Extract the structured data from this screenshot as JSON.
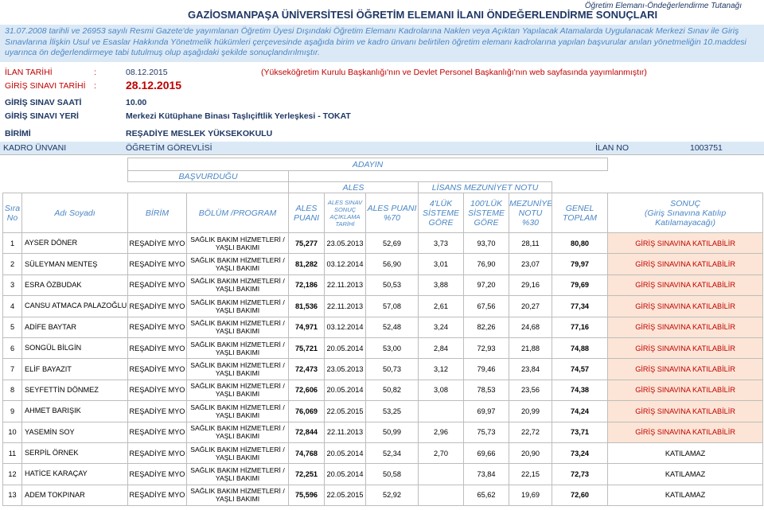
{
  "header": {
    "university_title": "GAZİOSMANPAŞA ÜNİVERSİTESİ ÖĞRETİM ELEMANI İLANI ÖNDEĞERLENDİRME SONUÇLARI",
    "corner_title": "Öğretim Elemanı-Öndeğerlendirme Tutanağı"
  },
  "intro": "31.07.2008 tarihli ve 26953 sayılı Resmi Gazete'de yayımlanan Öğretim Üyesi Dışındaki Öğretim Elemanı Kadrolarına Naklen veya Açıktan Yapılacak Atamalarda Uygulanacak Merkezi Sınav ile Giriş Sınavlarına İlişkin Usul ve Esaslar Hakkında Yönetmelik hükümleri çerçevesinde aşağıda birim ve kadro ünvanı belirtilen öğretim elemanı kadrolarına yapılan başvurular anılan yönetmeliğin 10.maddesi uyarınca ön değerlendirmeye tabi tutulmuş olup aşağıdaki şekilde sonuçlandırılmıştır.",
  "info": {
    "ilan_label": "İLAN TARİHİ",
    "ilan_colon": ":",
    "ilan_value": "08.12.2015",
    "ilan_note": "(Yükseköğretim Kurulu Başkanlığı'nın ve Devlet Personel Başkanlığı'nın web sayfasında yayımlanmıştır)",
    "giris_label": "GİRİŞ SINAVI TARİHİ",
    "giris_colon": ":",
    "giris_value": "28.12.2015",
    "saat_label": "GİRİŞ SINAV SAATİ",
    "saat_value": "10.00",
    "yer_label": "GİRİŞ SINAVI YERİ",
    "yer_value": "Merkezi Kütüphane Binası Taşlıçiftlik Yerleşkesi - TOKAT",
    "birim_label": "BİRİMİ",
    "birim_value": "REŞADİYE MESLEK YÜKSEKOKULU"
  },
  "kadro": {
    "label": "KADRO ÜNVANI",
    "value": "ÖĞRETİM GÖREVLİSİ",
    "ilan_no_label": "İLAN NO",
    "ilan_no_value": "1003751"
  },
  "table_headers": {
    "adayin": "ADAYIN",
    "basvurdugu": "BAŞVURDUĞU",
    "ales_group": "ALES",
    "lisans_group": "LİSANS MEZUNİYET NOTU",
    "sira": "Sıra",
    "no": "No",
    "adi_soyadi": "Adı Soyadı",
    "birim": "BİRİM",
    "bolum": "BÖLÜM /PROGRAM",
    "ales_puani_1": "ALES",
    "ales_puani_2": "PUANI",
    "ales_sinav_1": "ALES SINAV",
    "ales_sinav_2": "SONUÇ",
    "ales_sinav_3": "AÇIKLAMA",
    "ales_sinav_4": "TARİHİ",
    "ales_70_1": "ALES PUANI",
    "ales_70_2": "%70",
    "dortluk_1": "4'LÜK",
    "dortluk_2": "SİSTEME",
    "dortluk_3": "GÖRE",
    "yuzluk_1": "100'LÜK",
    "yuzluk_2": "SİSTEME",
    "yuzluk_3": "GÖRE",
    "mez_1": "MEZUNİYET",
    "mez_2": "NOTU",
    "mez_3": "%30",
    "genel_1": "GENEL",
    "genel_2": "TOPLAM",
    "sonuc_1": "SONUÇ",
    "sonuc_2": "(Giriş Sınavına Katılıp",
    "sonuc_3": "Katılamayacağı)"
  },
  "rows": [
    {
      "no": "1",
      "name": "AYSER DÖNER",
      "birim": "REŞADİYE MYO",
      "bolum": "SAĞLIK BAKIM HİZMETLERİ / YAŞLI BAKIMI",
      "ales": "75,277",
      "tarih": "23.05.2013",
      "ales70": "52,69",
      "d4": "3,73",
      "d100": "93,70",
      "mez30": "28,11",
      "toplam": "80,80",
      "sonuc": "GİRİŞ SINAVINA KATILABİLİR",
      "ok": true
    },
    {
      "no": "2",
      "name": "SÜLEYMAN MENTEŞ",
      "birim": "REŞADİYE MYO",
      "bolum": "SAĞLIK BAKIM HİZMETLERİ / YAŞLI BAKIMI",
      "ales": "81,282",
      "tarih": "03.12.2014",
      "ales70": "56,90",
      "d4": "3,01",
      "d100": "76,90",
      "mez30": "23,07",
      "toplam": "79,97",
      "sonuc": "GİRİŞ SINAVINA KATILABİLİR",
      "ok": true
    },
    {
      "no": "3",
      "name": "ESRA ÖZBUDAK",
      "birim": "REŞADİYE MYO",
      "bolum": "SAĞLIK BAKIM HİZMETLERİ / YAŞLI BAKIMI",
      "ales": "72,186",
      "tarih": "22.11.2013",
      "ales70": "50,53",
      "d4": "3,88",
      "d100": "97,20",
      "mez30": "29,16",
      "toplam": "79,69",
      "sonuc": "GİRİŞ SINAVINA KATILABİLİR",
      "ok": true
    },
    {
      "no": "4",
      "name": "CANSU ATMACA PALAZOĞLU",
      "birim": "REŞADİYE MYO",
      "bolum": "SAĞLIK BAKIM HİZMETLERİ / YAŞLI BAKIMI",
      "ales": "81,536",
      "tarih": "22.11.2013",
      "ales70": "57,08",
      "d4": "2,61",
      "d100": "67,56",
      "mez30": "20,27",
      "toplam": "77,34",
      "sonuc": "GİRİŞ SINAVINA KATILABİLİR",
      "ok": true
    },
    {
      "no": "5",
      "name": "ADİFE BAYTAR",
      "birim": "REŞADİYE MYO",
      "bolum": "SAĞLIK BAKIM HİZMETLERİ / YAŞLI BAKIMI",
      "ales": "74,971",
      "tarih": "03.12.2014",
      "ales70": "52,48",
      "d4": "3,24",
      "d100": "82,26",
      "mez30": "24,68",
      "toplam": "77,16",
      "sonuc": "GİRİŞ SINAVINA KATILABİLİR",
      "ok": true
    },
    {
      "no": "6",
      "name": "SONGÜL BİLGİN",
      "birim": "REŞADİYE MYO",
      "bolum": "SAĞLIK BAKIM HİZMETLERİ / YAŞLI BAKIMI",
      "ales": "75,721",
      "tarih": "20.05.2014",
      "ales70": "53,00",
      "d4": "2,84",
      "d100": "72,93",
      "mez30": "21,88",
      "toplam": "74,88",
      "sonuc": "GİRİŞ SINAVINA KATILABİLİR",
      "ok": true
    },
    {
      "no": "7",
      "name": "ELİF BAYAZIT",
      "birim": "REŞADİYE MYO",
      "bolum": "SAĞLIK BAKIM HİZMETLERİ / YAŞLI BAKIMI",
      "ales": "72,473",
      "tarih": "23.05.2013",
      "ales70": "50,73",
      "d4": "3,12",
      "d100": "79,46",
      "mez30": "23,84",
      "toplam": "74,57",
      "sonuc": "GİRİŞ SINAVINA KATILABİLİR",
      "ok": true
    },
    {
      "no": "8",
      "name": "SEYFETTİN DÖNMEZ",
      "birim": "REŞADİYE MYO",
      "bolum": "SAĞLIK BAKIM HİZMETLERİ / YAŞLI BAKIMI",
      "ales": "72,606",
      "tarih": "20.05.2014",
      "ales70": "50,82",
      "d4": "3,08",
      "d100": "78,53",
      "mez30": "23,56",
      "toplam": "74,38",
      "sonuc": "GİRİŞ SINAVINA KATILABİLİR",
      "ok": true
    },
    {
      "no": "9",
      "name": "AHMET BARIŞIK",
      "birim": "REŞADİYE MYO",
      "bolum": "SAĞLIK BAKIM HİZMETLERİ / YAŞLI BAKIMI",
      "ales": "76,069",
      "tarih": "22.05.2015",
      "ales70": "53,25",
      "d4": "",
      "d100": "69,97",
      "mez30": "20,99",
      "toplam": "74,24",
      "sonuc": "GİRİŞ SINAVINA KATILABİLİR",
      "ok": true
    },
    {
      "no": "10",
      "name": "YASEMİN SOY",
      "birim": "REŞADİYE MYO",
      "bolum": "SAĞLIK BAKIM HİZMETLERİ / YAŞLI BAKIMI",
      "ales": "72,844",
      "tarih": "22.11.2013",
      "ales70": "50,99",
      "d4": "2,96",
      "d100": "75,73",
      "mez30": "22,72",
      "toplam": "73,71",
      "sonuc": "GİRİŞ SINAVINA KATILABİLİR",
      "ok": true
    },
    {
      "no": "11",
      "name": "SERPİL ÖRNEK",
      "birim": "REŞADİYE MYO",
      "bolum": "SAĞLIK BAKIM HİZMETLERİ / YAŞLI BAKIMI",
      "ales": "74,768",
      "tarih": "20.05.2014",
      "ales70": "52,34",
      "d4": "2,70",
      "d100": "69,66",
      "mez30": "20,90",
      "toplam": "73,24",
      "sonuc": "KATILAMAZ",
      "ok": false
    },
    {
      "no": "12",
      "name": "HATİCE KARAÇAY",
      "birim": "REŞADİYE MYO",
      "bolum": "SAĞLIK BAKIM HİZMETLERİ / YAŞLI BAKIMI",
      "ales": "72,251",
      "tarih": "20.05.2014",
      "ales70": "50,58",
      "d4": "",
      "d100": "73,84",
      "mez30": "22,15",
      "toplam": "72,73",
      "sonuc": "KATILAMAZ",
      "ok": false
    },
    {
      "no": "13",
      "name": "ADEM TOKPINAR",
      "birim": "REŞADİYE MYO",
      "bolum": "SAĞLIK BAKIM HİZMETLERİ / YAŞLI BAKIMI",
      "ales": "75,596",
      "tarih": "22.05.2015",
      "ales70": "52,92",
      "d4": "",
      "d100": "65,62",
      "mez30": "19,69",
      "toplam": "72,60",
      "sonuc": "KATILAMAZ",
      "ok": false
    }
  ]
}
